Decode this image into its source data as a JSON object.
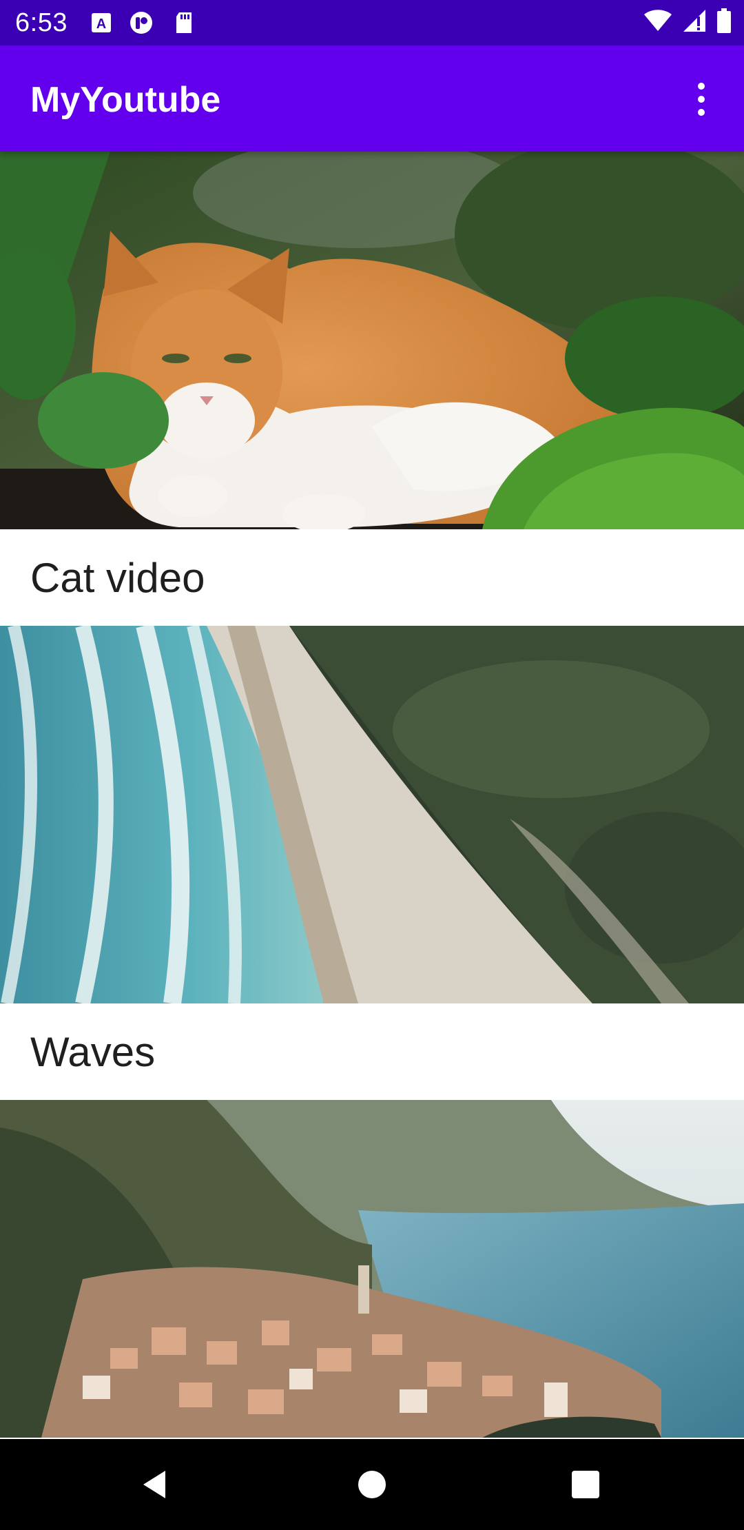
{
  "status_bar": {
    "time": "6:53",
    "left_icons": [
      "keyboard-a-icon",
      "app-notification-icon",
      "sd-card-icon"
    ],
    "right_icons": [
      "wifi-icon",
      "signal-icon",
      "battery-icon"
    ]
  },
  "app_bar": {
    "title": "MyYoutube",
    "overflow_icon": "more-vert-icon"
  },
  "videos": [
    {
      "title": "Cat video",
      "thumbnail": "orange and white cat lying among green plants"
    },
    {
      "title": "Waves",
      "thumbnail": "aerial view of ocean waves on a sandy beach next to a forest"
    },
    {
      "title": "",
      "thumbnail": "aerial view of a lakeside village below mountains"
    }
  ],
  "nav_bar": {
    "icons": [
      "back-icon",
      "home-icon",
      "recents-icon"
    ]
  },
  "colors": {
    "status_bar": "#3b00b3",
    "app_bar": "#6200ee",
    "nav_bar": "#000000",
    "caption_text": "#1f1f1f"
  }
}
